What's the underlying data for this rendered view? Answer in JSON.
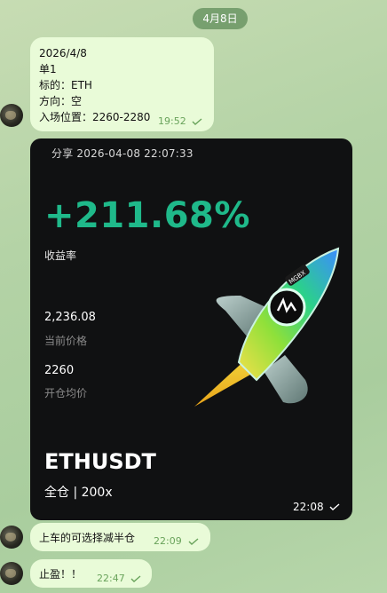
{
  "date_divider": "4月8日",
  "message1": {
    "lines": [
      "2026/4/8",
      "单1",
      "标的：ETH",
      "方向：空",
      "入场位置：2260-2280"
    ],
    "time": "19:52"
  },
  "share_card": {
    "share_label": "分享 2026-04-08 22:07:33",
    "pnl_percent": "+211.68%",
    "pnl_label": "收益率",
    "current_price": "2,236.08",
    "current_price_label": "当前价格",
    "entry_price": "2260",
    "entry_price_label": "开仓均价",
    "pair": "ETHUSDT",
    "mode": "全仓 | 200x",
    "logo_text": "MGBX",
    "time": "22:08"
  },
  "message2": {
    "text": "上车的可选择减半仓",
    "time": "22:09"
  },
  "message3": {
    "text": "止盈！！",
    "time": "22:47"
  },
  "colors": {
    "bubble": "#e9fbd8",
    "profit_green": "#1fb98a",
    "time_green": "#69a35b"
  },
  "icons": [
    "avatar",
    "double-check-icon",
    "rocket-graphic"
  ]
}
